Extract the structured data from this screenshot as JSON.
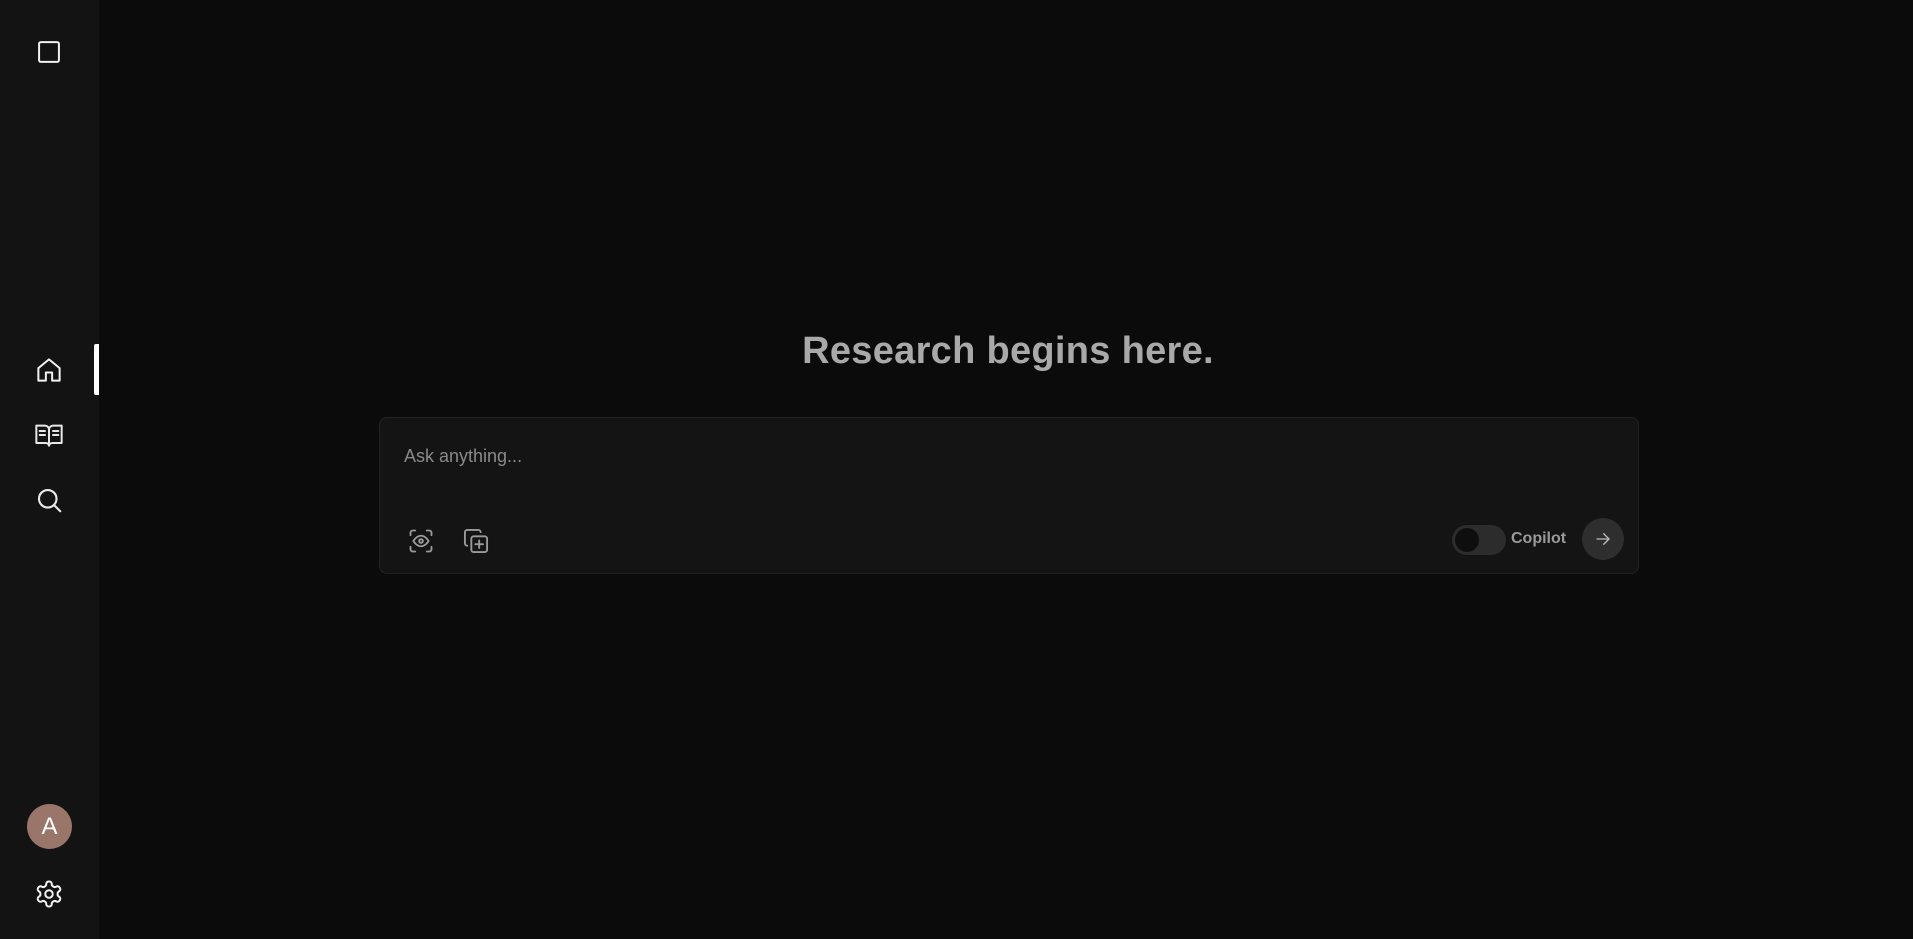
{
  "sidebar": {
    "new_chat_icon": "square-icon",
    "items": [
      {
        "name": "home",
        "icon": "home-icon",
        "active": true
      },
      {
        "name": "library",
        "icon": "book-open-icon",
        "active": false
      },
      {
        "name": "discover",
        "icon": "search-icon",
        "active": false
      }
    ],
    "avatar_initial": "A",
    "avatar_color": "#9a756a",
    "settings_icon": "gear-icon"
  },
  "main": {
    "headline": "Research begins here.",
    "search": {
      "placeholder": "Ask anything...",
      "value": "",
      "focus_icon": "scan-eye-icon",
      "attach_icon": "copy-plus-icon",
      "copilot_label": "Copilot",
      "copilot_enabled": false,
      "submit_icon": "arrow-right-icon"
    }
  },
  "colors": {
    "background": "#0b0b0b",
    "sidebar": "#131313",
    "composer": "#141414",
    "headline": "#a9a9a9"
  }
}
